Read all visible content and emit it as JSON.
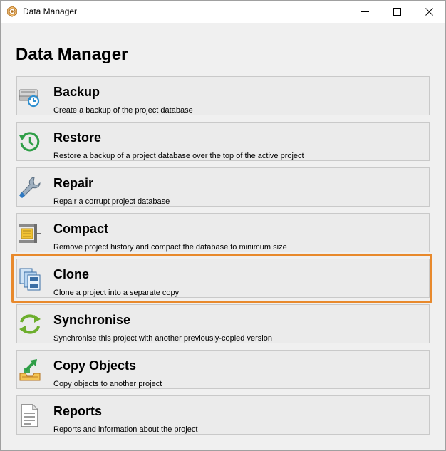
{
  "window": {
    "title": "Data Manager",
    "app_icon": "hexagon-target-icon",
    "controls": {
      "minimize_icon": "minimize-icon",
      "maximize_icon": "maximize-icon",
      "close_icon": "close-icon"
    }
  },
  "page": {
    "heading": "Data Manager"
  },
  "items": [
    {
      "name": "Backup",
      "description": "Create a backup of the project database",
      "icon": "backup-drive-icon"
    },
    {
      "name": "Restore",
      "description": "Restore a backup of a project database over the top of the active project",
      "icon": "restore-clock-icon"
    },
    {
      "name": "Repair",
      "description": "Repair a corrupt project database",
      "icon": "wrench-icon"
    },
    {
      "name": "Compact",
      "description": "Remove project history and compact the database to minimum size",
      "icon": "vise-icon"
    },
    {
      "name": "Clone",
      "description": "Clone a project into a separate copy",
      "icon": "clone-database-icon"
    },
    {
      "name": "Synchronise",
      "description": "Synchronise this project with another previously-copied version",
      "icon": "sync-arrows-icon"
    },
    {
      "name": "Copy Objects",
      "description": "Copy objects to another project",
      "icon": "copy-to-tray-icon"
    },
    {
      "name": "Reports",
      "description": "Reports and information about the project",
      "icon": "report-document-icon"
    }
  ],
  "highlight_color": "#e8892c"
}
